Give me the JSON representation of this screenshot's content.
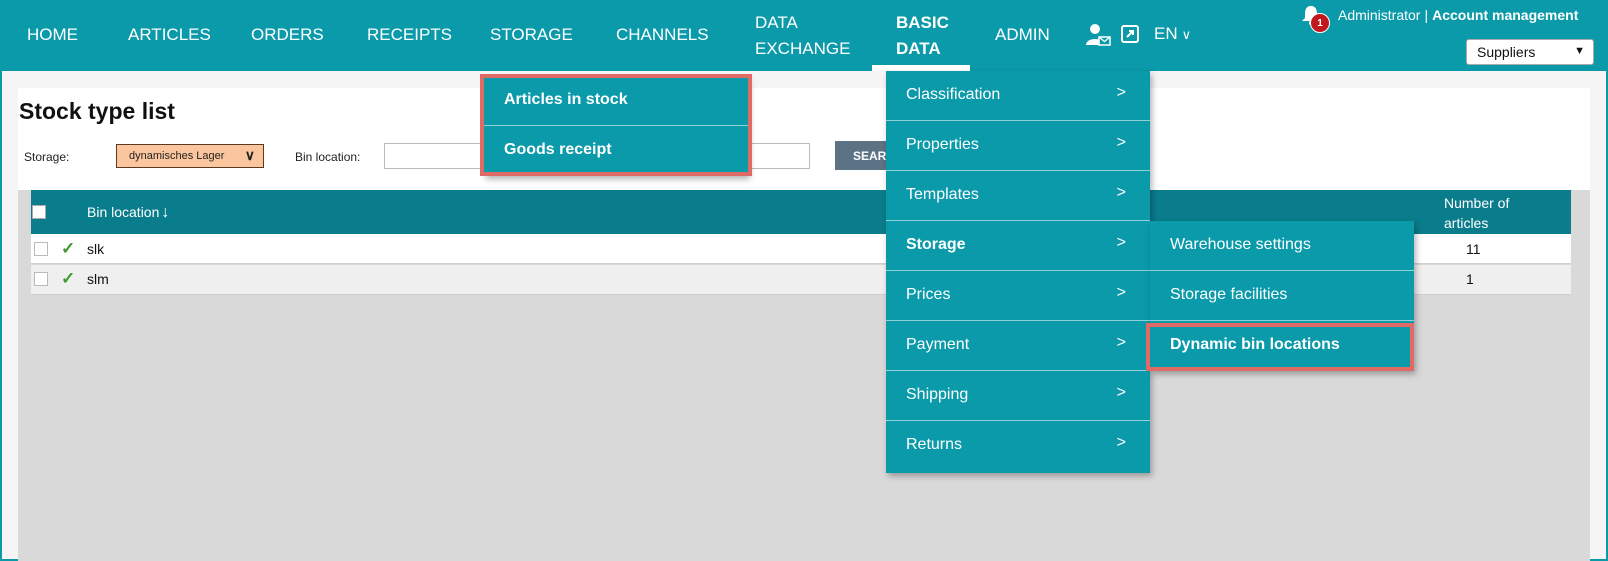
{
  "nav": {
    "items": [
      {
        "label": "HOME"
      },
      {
        "label": "ARTICLES"
      },
      {
        "label": "ORDERS"
      },
      {
        "label": "RECEIPTS"
      },
      {
        "label": "STORAGE"
      },
      {
        "label": "CHANNELS"
      },
      {
        "label_line1": "DATA",
        "label_line2": "EXCHANGE"
      },
      {
        "label_line1": "BASIC",
        "label_line2": "DATA"
      },
      {
        "label": "ADMIN"
      }
    ],
    "language": "EN",
    "notification_count": "1",
    "user_name": "Administrator",
    "separator": "|",
    "account_link": "Account management",
    "context_select": "Suppliers"
  },
  "page": {
    "title": "Stock type list",
    "storage_label": "Storage:",
    "storage_value": "dynamisches Lager",
    "bin_location_label": "Bin location:",
    "bin_location_value": "",
    "search_button": "SEARCH"
  },
  "table": {
    "columns": {
      "bin_location": "Bin location",
      "number_line1": "Number of",
      "number_line2": "articles"
    },
    "rows": [
      {
        "bin": "slk",
        "count": "11"
      },
      {
        "bin": "slm",
        "count": "1"
      }
    ]
  },
  "storage_submenu": {
    "items": [
      {
        "label": "Articles in stock"
      },
      {
        "label": "Goods receipt"
      }
    ]
  },
  "basic_data_menu": {
    "items": [
      {
        "label": "Classification",
        "chevron": ">"
      },
      {
        "label": "Properties",
        "chevron": ">"
      },
      {
        "label": "Templates",
        "chevron": ">"
      },
      {
        "label": "Storage",
        "chevron": ">"
      },
      {
        "label": "Prices",
        "chevron": ">"
      },
      {
        "label": "Payment",
        "chevron": ">"
      },
      {
        "label": "Shipping",
        "chevron": ">"
      },
      {
        "label": "Returns",
        "chevron": ">"
      }
    ]
  },
  "storage_flyout": {
    "items": [
      {
        "label": "Warehouse settings"
      },
      {
        "label": "Storage facilities"
      },
      {
        "label": "Dynamic bin locations"
      }
    ]
  },
  "colors": {
    "nav_bg": "#0b9aaa",
    "table_header": "#0a7d8c",
    "highlight": "#e06a66",
    "storage_select_bg": "#fbc69d"
  }
}
